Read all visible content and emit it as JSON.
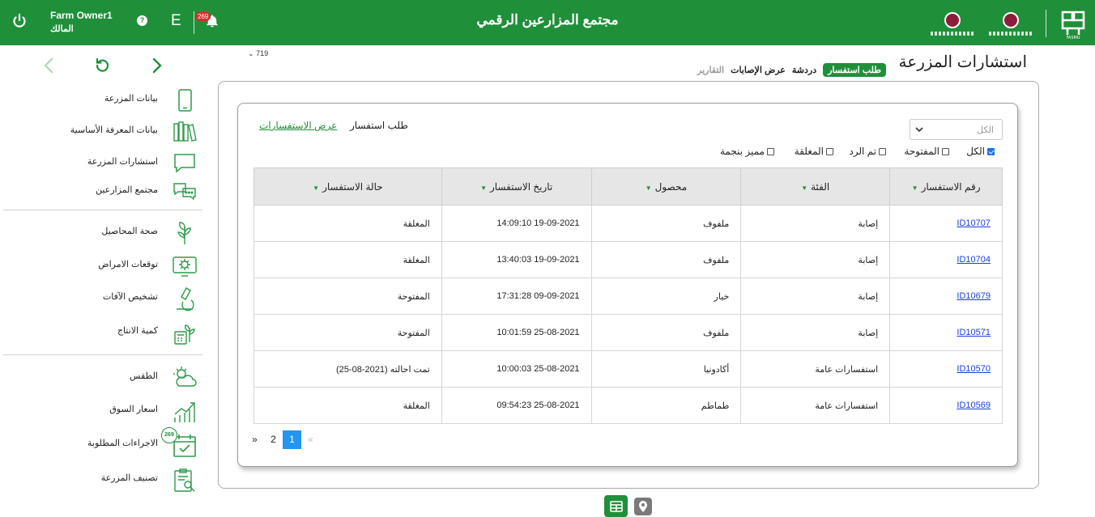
{
  "header": {
    "title": "مجتمع المزارعين الرقمي",
    "user_name": "Farm Owner1",
    "user_role": "المالك",
    "help_label": "?",
    "language_label": "E",
    "notification_count": "269"
  },
  "sidebar": {
    "items": [
      {
        "label": "بيانات المزرعة",
        "icon": "tablet-icon"
      },
      {
        "label": "بيانات المعرفة الأساسية",
        "icon": "books-icon"
      },
      {
        "label": "استشارات المزرعة",
        "icon": "chat-bubble-icon"
      },
      {
        "label": "مجتمع المزارعين",
        "icon": "community-chat-icon"
      },
      {
        "label": "صحة المحاصيل",
        "icon": "plant-icon"
      },
      {
        "label": "توقعات الامراض",
        "icon": "virus-monitor-icon"
      },
      {
        "label": "تشخيص الآفات",
        "icon": "microscope-icon"
      },
      {
        "label": "كمية الانتاج",
        "icon": "calculator-plant-icon"
      },
      {
        "label": "الطقس",
        "icon": "weather-icon"
      },
      {
        "label": "اسعار السوق",
        "icon": "market-chart-icon"
      },
      {
        "label": "الاجراءات المطلوبة",
        "icon": "calendar-check-icon",
        "badge": "269"
      },
      {
        "label": "تصنيف المزرعة",
        "icon": "clipboard-search-icon"
      }
    ]
  },
  "version": "719",
  "page_title": "استشارات المزرعة",
  "tabs": [
    {
      "label": "طلب استفسار",
      "active": true
    },
    {
      "label": "دردشة"
    },
    {
      "label": "عرض الإصابات"
    },
    {
      "label": "التقارير",
      "disabled": true
    }
  ],
  "inquiry": {
    "request_label": "طلب استفسار",
    "view_link": "عرض الاستفسارات",
    "filter_selected": "الكل",
    "filters": [
      {
        "label": "الكل",
        "checked": true
      },
      {
        "label": "المفتوحة",
        "checked": false
      },
      {
        "label": "تم الرد",
        "checked": false
      },
      {
        "label": "المغلقة",
        "checked": false
      },
      {
        "label": "مميز بنجمة",
        "checked": false
      }
    ]
  },
  "table": {
    "columns": [
      "رقم الاستفسار",
      "الفئة",
      "محصول",
      "تاريخ الاستفسار",
      "حالة الاستفسار"
    ],
    "rows": [
      [
        "ID10707",
        "إصابة",
        "ملفوف",
        "19-09-2021 14:09:10",
        "المغلقة"
      ],
      [
        "ID10704",
        "إصابة",
        "ملفوف",
        "19-09-2021 13:40:03",
        "المغلقة"
      ],
      [
        "ID10679",
        "إصابة",
        "خيار",
        "09-09-2021 17:31:28",
        "المفتوحة"
      ],
      [
        "ID10571",
        "إصابة",
        "ملفوف",
        "25-08-2021 10:01:59",
        "المفتوحة"
      ],
      [
        "ID10570",
        "استفسارات عامة",
        "أكادونيا",
        "25-08-2021 10:00:03",
        "تمت احالته (2021-08-25)"
      ],
      [
        "ID10569",
        "استفسارات عامة",
        "طماطم",
        "25-08-2021 09:54:23",
        "المغلقة"
      ]
    ]
  },
  "pagination": {
    "prev": "«",
    "pages": [
      "1",
      "2"
    ],
    "current": "1",
    "next": "»"
  },
  "colors": {
    "primary": "#1f8f3a",
    "link": "#1a3fd8",
    "page_active": "#2196f3",
    "badge": "#d32f2f"
  }
}
